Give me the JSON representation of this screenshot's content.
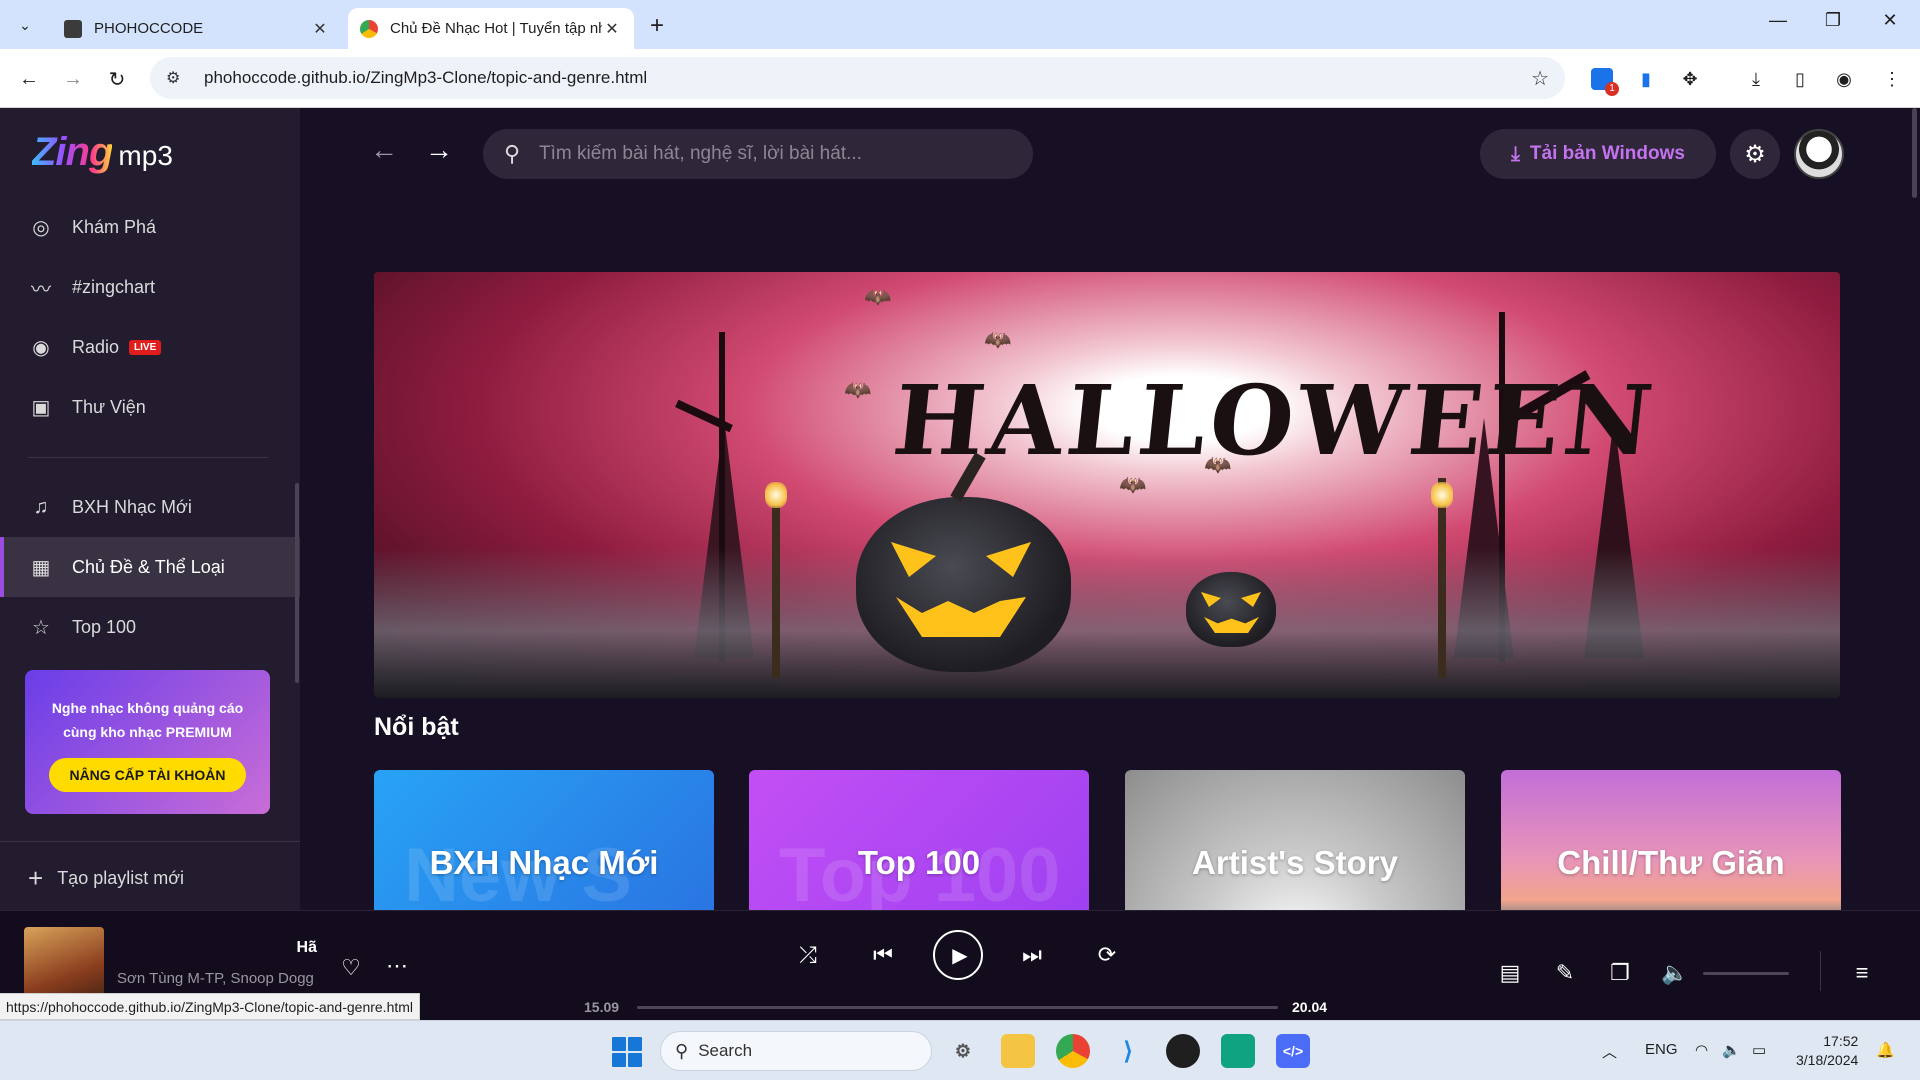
{
  "browser": {
    "tabs": [
      {
        "title": "PHOHOCCODE",
        "active": false
      },
      {
        "title": "Chủ Đề Nhạc Hot | Tuyển tập nhạc",
        "active": true
      }
    ],
    "url": "phohoccode.github.io/ZingMp3-Clone/topic-and-genre.html",
    "extension_badge": "1",
    "status_url": "https://phohoccode.github.io/ZingMp3-Clone/topic-and-genre.html"
  },
  "logo": {
    "zing": "Zing",
    "mp3": "mp3"
  },
  "sidebar": {
    "items": [
      {
        "label": "Khám Phá",
        "icon": "disc-icon"
      },
      {
        "label": "#zingchart",
        "icon": "chart-icon"
      },
      {
        "label": "Radio",
        "icon": "radio-icon",
        "badge": "LIVE"
      },
      {
        "label": "Thư Viện",
        "icon": "library-icon"
      },
      {
        "label": "BXH Nhạc Mới",
        "icon": "music-note-icon"
      },
      {
        "label": "Chủ Đề & Thể Loại",
        "icon": "category-icon",
        "active": true
      },
      {
        "label": "Top 100",
        "icon": "star-icon"
      }
    ],
    "premium": {
      "line1": "Nghe nhạc không quảng cáo",
      "line2": "cùng kho nhạc PREMIUM",
      "button": "NÂNG CẤP TÀI KHOẢN"
    },
    "new_playlist": "Tạo playlist mới"
  },
  "header": {
    "search_placeholder": "Tìm kiếm bài hát, nghệ sĩ, lời bài hát...",
    "download_label": "Tải bản Windows"
  },
  "banner": {
    "title": "HALLOWEEN"
  },
  "section": {
    "title": "Nổi bật"
  },
  "cards": [
    {
      "label": "BXH Nhạc Mới",
      "ghost": "New S"
    },
    {
      "label": "Top 100",
      "ghost": "Top 100"
    },
    {
      "label": "Artist's Story",
      "ghost": ""
    },
    {
      "label": "Chill/Thư Giãn",
      "ghost": ""
    }
  ],
  "player": {
    "song": "Hã",
    "artist": "Sơn Tùng M-TP, Snoop Dogg",
    "time_current": "15.09",
    "time_total": "20.04",
    "progress": 0.0,
    "volume": 0.0
  },
  "taskbar": {
    "search_label": "Search",
    "lang": "ENG",
    "time": "17:52",
    "date": "3/18/2024"
  },
  "colors": {
    "app_bg": "#170f23",
    "sidebar_bg": "#231b2e",
    "accent_purple": "#9b4de0",
    "download_text": "#c273ed",
    "premium_button": "#ffdb00",
    "live_badge": "#e01e1e"
  }
}
